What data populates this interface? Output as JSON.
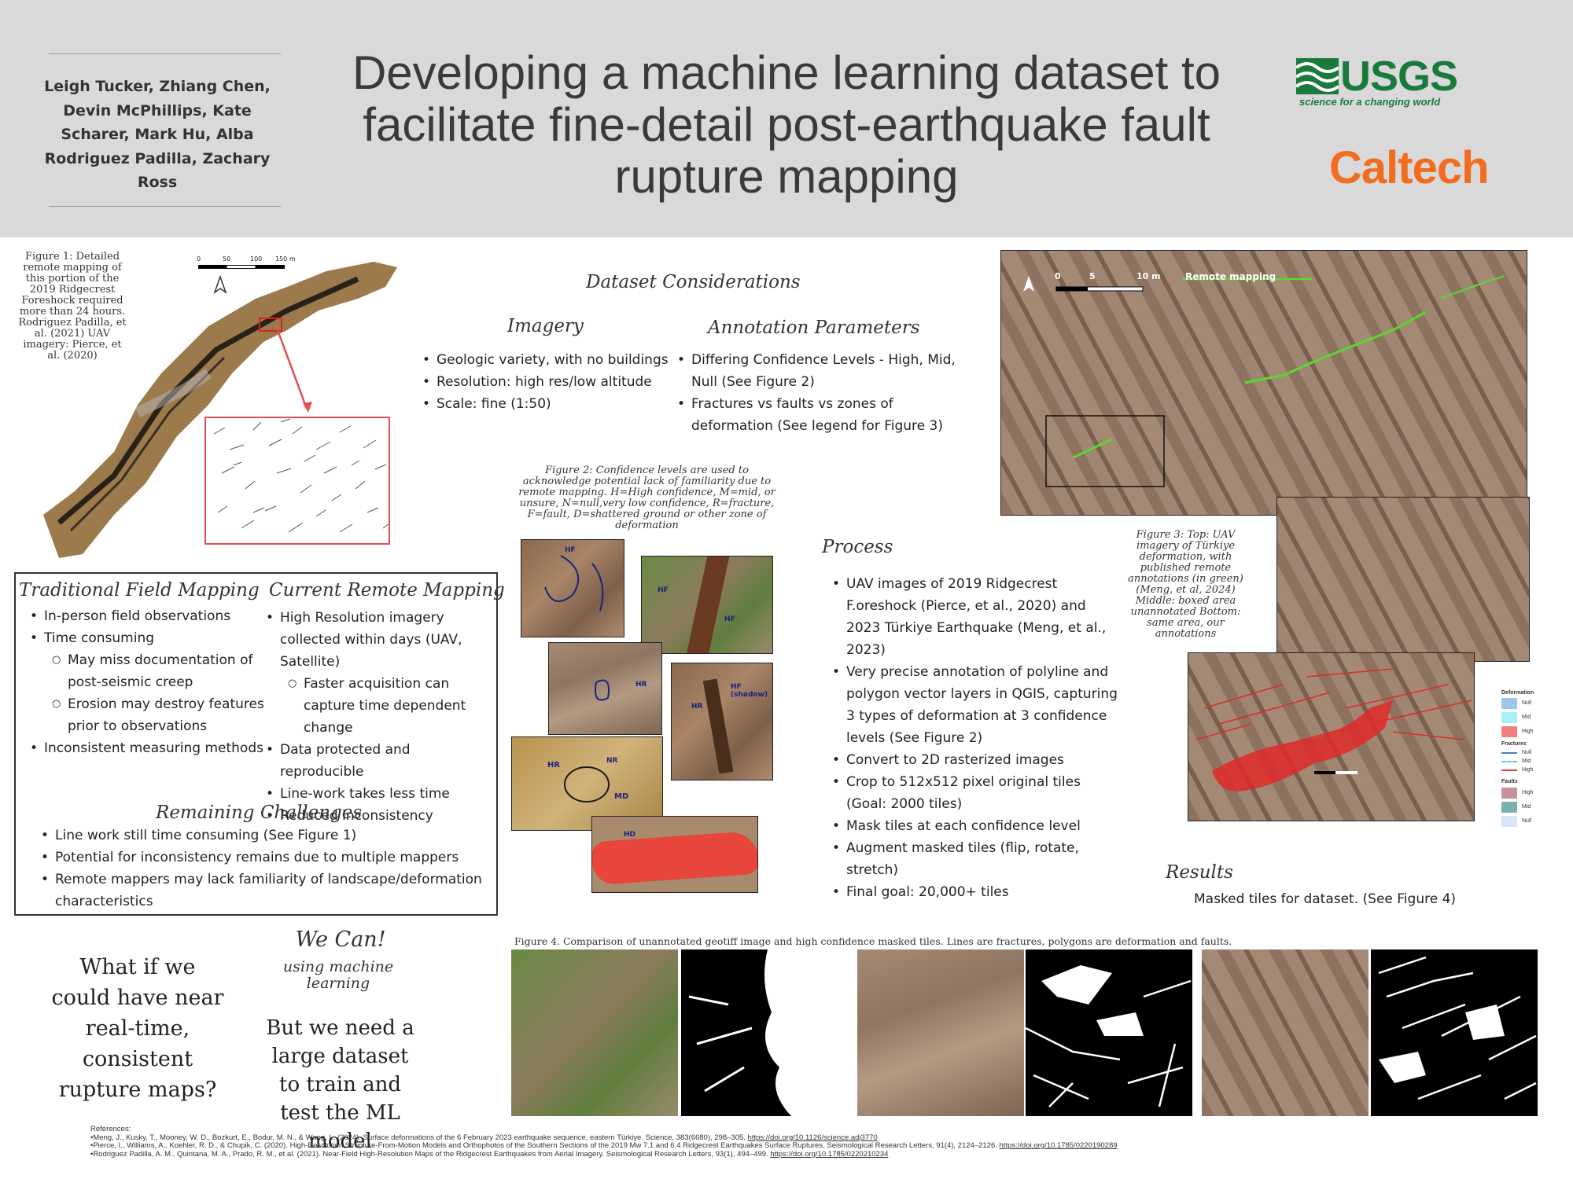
{
  "header": {
    "authors": "Leigh Tucker, Zhiang Chen, Devin McPhillips, Kate Scharer, Mark Hu, Alba Rodriguez Padilla, Zachary Ross",
    "title": "Developing a machine learning dataset to facilitate fine-detail post-earthquake fault rupture mapping",
    "usgs": "USGS",
    "usgs_tagline": "science for a changing world",
    "caltech": "Caltech"
  },
  "figure1": {
    "caption": "Figure 1: Detailed remote mapping of this portion of the 2019 Ridgecrest Foreshock required more than 24 hours. Rodriguez Padilla, et al. (2021) UAV imagery: Pierce, et al. (2020)",
    "scale_ticks": [
      "0",
      "50",
      "100",
      "150 m"
    ]
  },
  "dataset": {
    "heading": "Dataset Considerations",
    "imagery_heading": "Imagery",
    "imagery_items": [
      "Geologic variety, with no buildings",
      "Resolution: high res/low altitude",
      "Scale: fine (1:50)"
    ],
    "annotation_heading": "Annotation Parameters",
    "annotation_items": [
      "Differing Confidence Levels - High, Mid, Null (See Figure 2)",
      "Fractures vs faults vs zones of deformation (See legend for Figure 3)"
    ]
  },
  "figure2": {
    "caption": "Figure 2: Confidence levels are used to acknowledge potential lack of familiarity due to remote mapping. H=High confidence, M=mid, or unsure, N=null,very low confidence, R=fracture, F=fault, D=shattered ground or other zone of deformation",
    "labels": [
      "HF",
      "HF",
      "HF",
      "HR",
      "HR",
      "NR",
      "HF (shadow)",
      "HD",
      "HR",
      "MD",
      "HD"
    ]
  },
  "figure3": {
    "scale_ticks": [
      "0",
      "5",
      "10 m"
    ],
    "remote_label": "Remote mapping",
    "caption": "Figure 3: Top: UAV imagery of Türkiye deformation, with published remote annotations (in green) (Meng, et al, 2024) Middle: boxed area unannotated Bottom:  same area, our annotations",
    "legend": {
      "deformation": "Deformation",
      "fractures": "Fractures",
      "faults": "Faults",
      "null": "Null",
      "mid": "Mid",
      "high": "High",
      "colors": {
        "def_null": "#9fc5e8",
        "def_mid": "#a9f0f5",
        "def_high": "#f08080",
        "frac_null": "#4a7fbf",
        "frac_mid": "#6fb6f5",
        "frac_high": "#e04040",
        "fault_high": "#c9909a",
        "fault_mid": "#7ab3ae",
        "fault_null": "#d6e6f5"
      }
    }
  },
  "traditional": {
    "heading": "Traditional Field Mapping",
    "items": [
      {
        "text": "In-person field observations",
        "sub": false
      },
      {
        "text": "Time consuming",
        "sub": false
      },
      {
        "text": "May miss documentation of post-seismic creep",
        "sub": true
      },
      {
        "text": "Erosion may destroy features prior to observations",
        "sub": true
      },
      {
        "text": "Inconsistent measuring methods",
        "sub": false
      }
    ]
  },
  "current": {
    "heading": "Current Remote Mapping",
    "items": [
      {
        "text": "High Resolution imagery collected within days (UAV, Satellite)",
        "sub": false
      },
      {
        "text": "Faster acquisition can capture time dependent change",
        "sub": true
      },
      {
        "text": "Data protected and reproducible",
        "sub": false
      },
      {
        "text": "Line-work takes less time",
        "sub": false
      },
      {
        "text": "Reduced inconsistency",
        "sub": false
      }
    ]
  },
  "challenges": {
    "heading": "Remaining Challenges",
    "items": [
      "Line work still time consuming (See Figure 1)",
      "Potential for inconsistency remains due to multiple mappers",
      "Remote mappers may lack familiarity of landscape/deformation characteristics"
    ]
  },
  "process": {
    "heading": "Process",
    "items": [
      "UAV images of 2019 Ridgecrest F.oreshock (Pierce, et al., 2020) and 2023 Türkiye Earthquake (Meng, et al., 2023)",
      "Very precise annotation of polyline and polygon vector layers in QGIS, capturing 3 types of deformation at 3 confidence levels (See Figure 2)",
      "Convert to 2D rasterized images",
      "Crop to 512x512 pixel original tiles (Goal: 2000 tiles)",
      "Mask tiles at each confidence level",
      "Augment masked tiles (flip, rotate, stretch)",
      "Final goal: 20,000+ tiles"
    ]
  },
  "results": {
    "heading": "Results",
    "text": "Masked tiles for dataset. (See Figure 4)"
  },
  "whatif": {
    "question": "What if we could have near real-time, consistent rupture maps?",
    "we_can": "We Can!",
    "using": "using machine learning",
    "need": "But we need a large dataset to train and test the ML model"
  },
  "figure4": {
    "caption": "Figure 4.  Comparison of unannotated geotiff image and high confidence masked tiles.  Lines are fractures, polygons are deformation and faults."
  },
  "references": {
    "heading": "References:",
    "items": [
      {
        "text": "•Meng, J., Kusky, T., Mooney, W. D., Bozkurt, E., Bodur, M. N., & Wang, L. (2024). Surface deformations of the 6 February 2023 earthquake sequence, eastern Türkiye. Science, 383(6680), 298–305. ",
        "link": "https://doi.org/10.1126/science.adj3770"
      },
      {
        "text": "•Pierce, I., Williams, A., Koehler, R. D., & Chupik, C. (2020). High-Resolution Structure-From-Motion Models and Orthophotos of the Southern Sections of the 2019 Mw 7.1 and 6.4 Ridgecrest Earthquakes Surface Ruptures. Seismological Research Letters, 91(4), 2124–2126. ",
        "link": "https://doi.org/10.1785/0220190289"
      },
      {
        "text": "•Rodriguez Padilla, A. M., Quintana, M. A., Prado, R. M., et al. (2021). Near-Field High-Resolution Maps of the Ridgecrest Earthquakes from Aerial Imagery. Seismological Research Letters, 93(1), 494–499. ",
        "link": "https://doi.org/10.1785/0220210234"
      }
    ]
  }
}
